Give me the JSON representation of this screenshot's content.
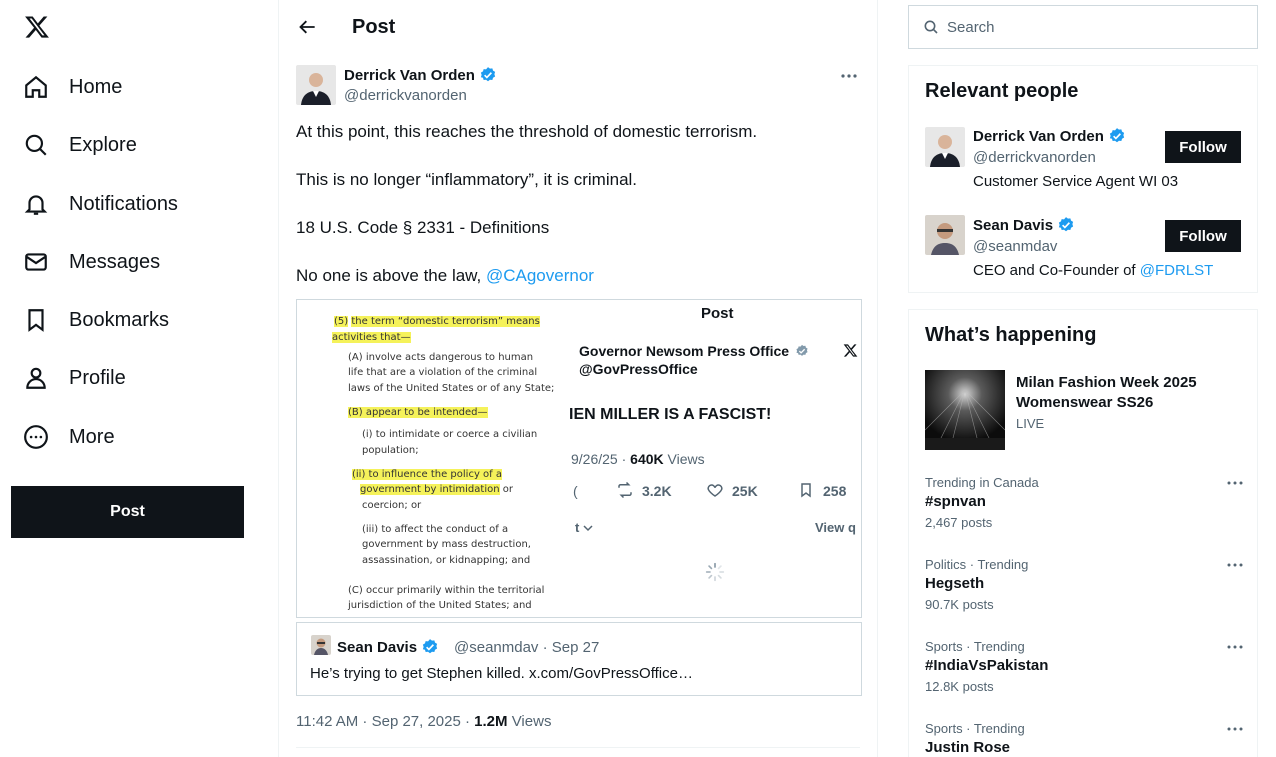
{
  "nav": {
    "logo": "x-logo",
    "items": [
      {
        "label": "Home",
        "icon": "home-icon"
      },
      {
        "label": "Explore",
        "icon": "search-icon"
      },
      {
        "label": "Notifications",
        "icon": "bell-icon"
      },
      {
        "label": "Messages",
        "icon": "envelope-icon"
      },
      {
        "label": "Bookmarks",
        "icon": "bookmark-icon"
      },
      {
        "label": "Profile",
        "icon": "person-icon"
      },
      {
        "label": "More",
        "icon": "more-circle-icon"
      }
    ],
    "post_label": "Post"
  },
  "header": {
    "title": "Post"
  },
  "tweet": {
    "author_name": "Derrick Van Orden",
    "author_handle": "@derrickvanorden",
    "lines": [
      "At this point, this reaches the threshold of domestic terrorism.",
      "This is no longer “inflammatory”, it is criminal.",
      "18 U.S. Code § 2331 - Definitions",
      "No one is above the law, "
    ],
    "mention": "@CAgovernor",
    "timestamp": "11:42 AM · Sep 27, 2025 · ",
    "views_count": "1.2M",
    "views_label": " Views"
  },
  "media": {
    "doc": {
      "l5_num": "(5)",
      "l5_text": "the term “domestic terrorism” means",
      "l5_cont": "activities that—",
      "a1": "(A) involve acts dangerous to human",
      "a2": "life that are a violation of the criminal",
      "a3": "laws of the United States or of any State;",
      "b1": "(B) appear to be intended—",
      "i1": "(i) to intimidate or coerce a civilian",
      "i2": "population;",
      "ii1": "(ii) to influence the policy of a",
      "ii2": "government by intimidation",
      "ii2b": " or",
      "ii3": "coercion; or",
      "iii1": "(iii) to affect the conduct of a",
      "iii2": "government by mass destruction,",
      "iii3": "assassination, or kidnapping; and",
      "c1": "(C) occur primarily within the territorial",
      "c2": "jurisdiction of the United States; and"
    },
    "shot": {
      "header": "Post",
      "name": "Governor Newsom Press Office",
      "handle": "@GovPressOffice",
      "headline": "IEN MILLER IS A FASCIST!",
      "date": "9/26/25 · ",
      "views_count": "640K",
      "views_label": " Views",
      "retweets": "3.2K",
      "likes": "25K",
      "bookmarks": "258",
      "partial": "t",
      "view_quotes": "View q"
    }
  },
  "quote": {
    "name": "Sean Davis",
    "meta": "@seanmdav · Sep 27",
    "text": "He’s trying to get Stephen killed. x.com/GovPressOffice…"
  },
  "search": {
    "placeholder": "Search"
  },
  "relevant": {
    "title": "Relevant people",
    "people": [
      {
        "name": "Derrick Van Orden",
        "handle": "@derrickvanorden",
        "bio": "Customer Service Agent WI 03",
        "bio_link": "",
        "follow": "Follow"
      },
      {
        "name": "Sean Davis",
        "handle": "@seanmdav",
        "bio": "CEO and Co-Founder of ",
        "bio_link": "@FDRLST",
        "follow": "Follow"
      }
    ]
  },
  "happening": {
    "title": "What’s happening",
    "event": {
      "title": "Milan Fashion Week 2025 Womenswear SS26",
      "status": "LIVE"
    },
    "trends": [
      {
        "category": "Trending in Canada",
        "name": "#spnvan",
        "count": "2,467 posts"
      },
      {
        "category": "Politics · Trending",
        "name": "Hegseth",
        "count": "90.7K posts"
      },
      {
        "category": "Sports · Trending",
        "name": "#IndiaVsPakistan",
        "count": "12.8K posts"
      },
      {
        "category": "Sports · Trending",
        "name": "Justin Rose",
        "count": ""
      }
    ]
  },
  "colors": {
    "accent": "#1d9bf0",
    "text": "#0f1419",
    "muted": "#536471",
    "highlight": "#f5f25a"
  }
}
